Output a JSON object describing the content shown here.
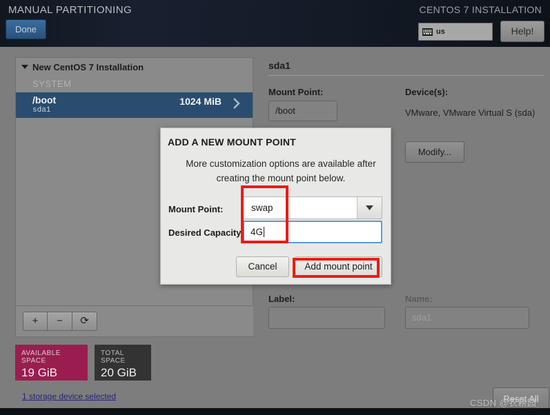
{
  "header": {
    "title": "MANUAL PARTITIONING",
    "installation_label": "CENTOS 7 INSTALLATION",
    "done_label": "Done",
    "keyboard_layout": "us",
    "keyboard_icon": "keyboard-icon",
    "help_label": "Help!"
  },
  "sidebar": {
    "group_title": "New CentOS 7 Installation",
    "section_label": "SYSTEM",
    "rows": [
      {
        "mount_point": "/boot",
        "device": "sda1",
        "size": "1024 MiB"
      }
    ],
    "toolbar": {
      "add_label": "+",
      "remove_label": "−",
      "refresh_label": "⟳"
    }
  },
  "space": {
    "available_label": "AVAILABLE SPACE",
    "available_value": "19 GiB",
    "total_label": "TOTAL SPACE",
    "total_value": "20 GiB",
    "available_color": "#9b1d50",
    "total_color": "#333333",
    "storage_link": "1 storage device selected"
  },
  "details": {
    "title": "sda1",
    "mount_point_label": "Mount Point:",
    "mount_point_value": "/boot",
    "devices_label": "Device(s):",
    "devices_value": "VMware, VMware Virtual S (sda)",
    "modify_label": "Modify...",
    "label_label": "Label:",
    "label_value": "",
    "name_label": "Name:",
    "name_value": "sda1"
  },
  "footer": {
    "reset_label": "Reset All"
  },
  "dialog": {
    "title": "ADD A NEW MOUNT POINT",
    "description": "More customization options are available after creating the mount point below.",
    "mount_point_label": "Mount Point:",
    "mount_point_value": "swap",
    "dropdown_icon": "chevron-down-icon",
    "capacity_label": "Desired Capacity",
    "capacity_value": "4G",
    "cancel_label": "Cancel",
    "add_label": "Add mount point"
  },
  "annotations": {
    "accent_color": "#ec1c15"
  },
  "watermark": {
    "text": "CSDN @农耕园"
  }
}
